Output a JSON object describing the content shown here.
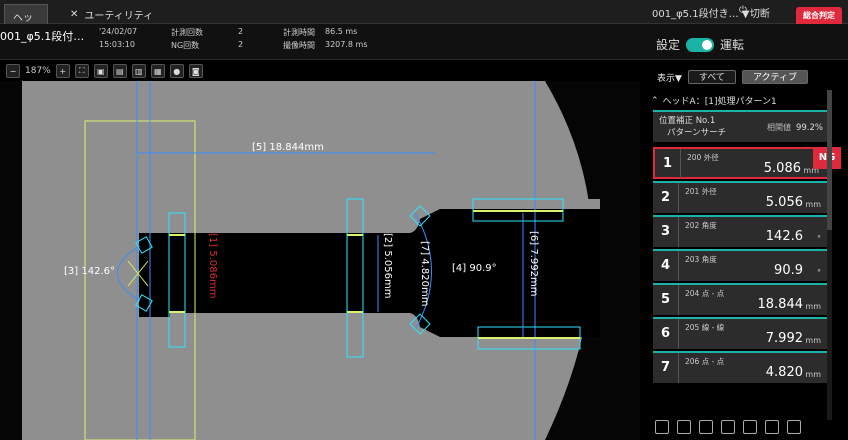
{
  "topbar": {
    "tab_head": "ヘッドA",
    "tab_util": "ユーティリティ",
    "program": "001_φ5.1段付き…",
    "program_arrow": "▼",
    "switch": "切断",
    "judge_label": "総合判定",
    "judge_value": "NG"
  },
  "info": {
    "program": "001_φ5.1段付…",
    "date": "'24/02/07",
    "time": "15:03:10",
    "count_label": "計測回数",
    "count_value": "2",
    "ng_label": "NG回数",
    "ng_value": "2",
    "meas_time_label": "計測時間",
    "meas_time_value": "86.5 ms",
    "capture_label": "撮像時間",
    "capture_value": "3207.8 ms"
  },
  "mode": {
    "left": "設定",
    "right": "運転"
  },
  "toolbar": {
    "zoom": "187%"
  },
  "filter": {
    "label": "表示▼",
    "all": "すべて",
    "active": "アクティブ"
  },
  "panel": {
    "head_title": "ヘッドA：[1]処理パターン1",
    "pos_title": "位置補正 No.1",
    "pos_sub": "パターンサーチ",
    "pos_val_label": "相関値",
    "pos_val": "99.2%",
    "rows": [
      {
        "num": "1",
        "label": "200 外径",
        "value": "5.086",
        "unit": "mm",
        "ng": "NG"
      },
      {
        "num": "2",
        "label": "201 外径",
        "value": "5.056",
        "unit": "mm"
      },
      {
        "num": "3",
        "label": "202 角度",
        "value": "142.6",
        "unit": "°"
      },
      {
        "num": "4",
        "label": "203 角度",
        "value": "90.9",
        "unit": "°"
      },
      {
        "num": "5",
        "label": "204 点 - 点",
        "value": "18.844",
        "unit": "mm"
      },
      {
        "num": "6",
        "label": "205 線 - 線",
        "value": "7.992",
        "unit": "mm"
      },
      {
        "num": "7",
        "label": "206 点 - 点",
        "value": "4.820",
        "unit": "mm"
      }
    ]
  },
  "annotations": {
    "a5": "[5]  18.844mm",
    "a3": "[3]  142.6°",
    "a1": "[1]  5.086mm",
    "a2": "[2]  5.056mm",
    "a7": "[7]  4.820mm",
    "a4": "[4]  90.9°",
    "a6": "[6]  7.992mm"
  },
  "colors": {
    "accent": "#1bb3a8",
    "ng": "#e0293d",
    "cyan": "#2ee6ff",
    "yellow": "#d8f06a",
    "blue": "#3a8cff"
  }
}
